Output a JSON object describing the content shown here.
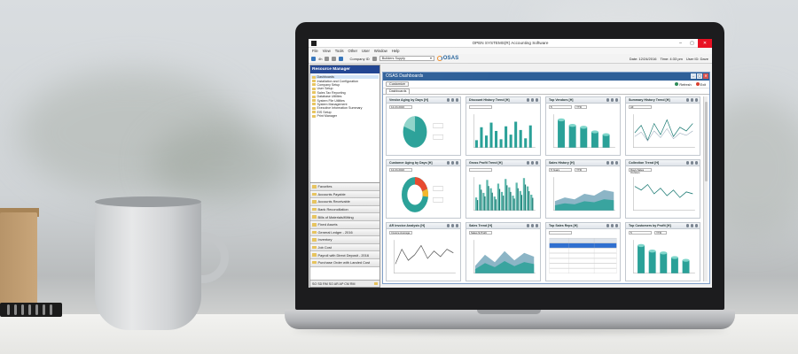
{
  "window": {
    "title": "OPEN SYSTEMS(R) Accounting Software",
    "controls": {
      "minimize": "–",
      "maximize": "▢",
      "close": "✕"
    }
  },
  "menu": [
    "File",
    "View",
    "Tools",
    "Other",
    "User",
    "Window",
    "Help"
  ],
  "toolbar": {
    "date_label": "4h",
    "company_label": "Company ID",
    "company_value": "Builders Supply",
    "logo_text": "OSAS",
    "date_info": "Date: 12/24/2016",
    "time_info": "Time: 4:33 pm",
    "user_info": "User ID: Dave"
  },
  "resource_manager": {
    "title": "Resource Manager",
    "tree": [
      "Dashboards",
      "Installation and Configuration",
      "Company Setup",
      "User Setup",
      "Sales Tax Reporting",
      "Database Utilities",
      "System File Utilities",
      "System Management",
      "Executive Information Summary",
      "EIS Setup",
      "Print Manager"
    ],
    "modules": [
      "Favorites",
      "Accounts Payable",
      "Accounts Receivable",
      "Bank Reconciliation",
      "Bills of Materials/Kitting",
      "Fixed Assets",
      "General Ledger - 2016",
      "Inventory",
      "Job Cost",
      "Payroll with Direct Deposit - 2016",
      "Purchase Order with Landed Cost"
    ],
    "footer": "SO  SD  RM  SO  AR  AP  CM  RM"
  },
  "dashboard": {
    "title": "OSAS Dashboards",
    "customize_label": "Customize",
    "refresh_label": "Refresh",
    "exit_label": "Exit",
    "tab_label": "Dashboards",
    "panels": [
      {
        "title": "Vendor Aging by Days [H]",
        "sub1": "12.24.2016",
        "chart": "pie"
      },
      {
        "title": "Discount History Trend [H]",
        "sub1": "",
        "chart": "bars-thin"
      },
      {
        "title": "Top Vendors [H]",
        "sub1": "5",
        "sub2": "YTD",
        "chart": "bars3d"
      },
      {
        "title": "Summary History Trend [H]",
        "sub1": "All",
        "chart": "line"
      },
      {
        "title": "Customer Aging by Days [H]",
        "sub1": "12.24.2016",
        "chart": "donut"
      },
      {
        "title": "Gross Profit Trend [H]",
        "sub1": "",
        "chart": "bars-dense"
      },
      {
        "title": "Sales History [H]",
        "sub1": "5 Years",
        "sub2": "YTD",
        "chart": "area"
      },
      {
        "title": "Collection Trend [H]",
        "sub1": "Days Sales Outstan",
        "chart": "line2"
      },
      {
        "title": "AR Invoice Analysis [H]",
        "sub1": "Invoice Average",
        "chart": "line3"
      },
      {
        "title": "Sales Trend [H]",
        "sub1": "Sales $ Profit",
        "chart": "area2"
      },
      {
        "title": "Top Sales Reps [H]",
        "sub1": "",
        "chart": "table"
      },
      {
        "title": "Top Customers by Profit [H]",
        "sub1": "5",
        "sub2": "YTD",
        "chart": "bars3d"
      }
    ]
  },
  "colors": {
    "teal": "#2aa198",
    "teal_dark": "#1b7a73",
    "navy": "#1a3f8f",
    "dash_title": "#2e5f98"
  }
}
